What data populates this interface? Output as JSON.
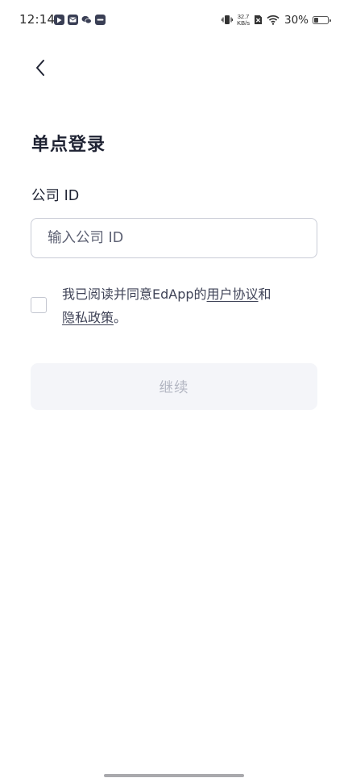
{
  "status_bar": {
    "time": "12:14",
    "net_speed_value": "32.7",
    "net_speed_unit": "KB/s",
    "battery_percent": "30%",
    "battery_level": 0.3,
    "notification_icons": [
      "play-store-icon",
      "mail-icon",
      "wechat-icon",
      "app-icon"
    ]
  },
  "header": {
    "back_icon": "chevron-left-icon"
  },
  "page": {
    "title": "单点登录"
  },
  "form": {
    "company_id_label": "公司 ID",
    "company_id_placeholder": "输入公司 ID",
    "company_id_value": ""
  },
  "agreement": {
    "prefix": "我已阅读并同意EdApp的",
    "terms_link": "用户协议",
    "conjunction": "和",
    "privacy_link": "隐私政策",
    "suffix": "。",
    "checked": false
  },
  "actions": {
    "continue_label": "继续",
    "continue_enabled": false
  },
  "colors": {
    "text_primary": "#1f2333",
    "input_border": "#c9ccd6",
    "button_disabled_bg": "#f4f5f9",
    "button_disabled_text": "#b3b6c2"
  }
}
